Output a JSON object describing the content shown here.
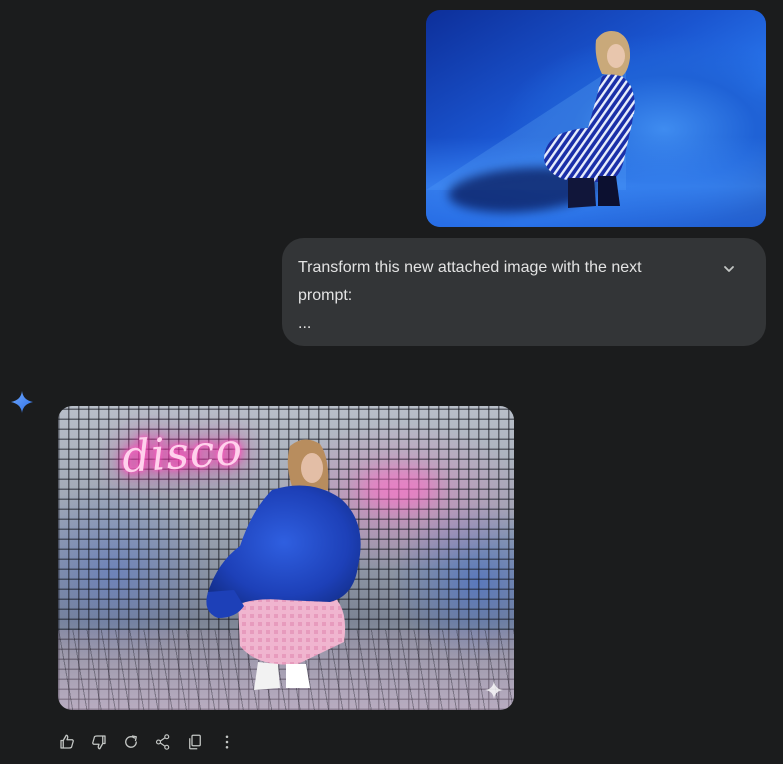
{
  "user_message": {
    "image": {
      "icon": "uploaded-photo",
      "colors": {
        "background": "#1f62d6",
        "floor": "#4a9bff"
      }
    },
    "prompt": {
      "text": "Transform this new attached image with the next\nprompt:\n...",
      "expand_icon": "chevron-down-icon"
    }
  },
  "response": {
    "avatar_icon": "gemini-sparkle-icon",
    "accent_color": "#4b8df8",
    "generated_image": {
      "sign_text": "disco",
      "watermark_icon": "sparkle-icon",
      "colors": {
        "neon": "#ff2fae",
        "tiles": "#9aa2b0"
      }
    },
    "actions": [
      {
        "name": "good-response",
        "icon": "thumbs-up-icon"
      },
      {
        "name": "bad-response",
        "icon": "thumbs-down-icon"
      },
      {
        "name": "regenerate",
        "icon": "redo-icon"
      },
      {
        "name": "share",
        "icon": "share-icon"
      },
      {
        "name": "copy",
        "icon": "copy-icon"
      },
      {
        "name": "more",
        "icon": "more-vert-icon"
      }
    ]
  },
  "theme": {
    "background": "#1b1c1d",
    "bubble": "#333537",
    "text": "#e3e3e3",
    "icon": "#c4c7c5"
  }
}
